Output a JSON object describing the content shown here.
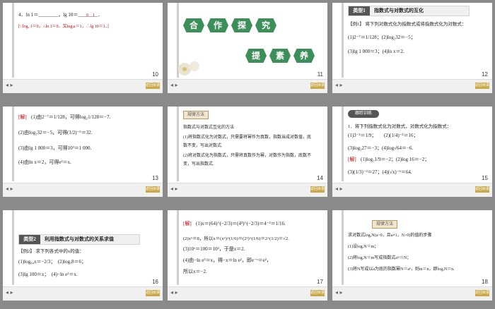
{
  "slides": [
    {
      "page": "10",
      "line1": "4．ln 1＝________，lg 10＝________．",
      "answer1": "0　1",
      "answer2": "[∵logₐ 1＝0，∴ln 1＝0．又logₐa＝1，∴lg 10＝1．]",
      "btn": "返回目录"
    },
    {
      "page": "11",
      "title_chars": [
        "合",
        "作",
        "探",
        "究"
      ],
      "sub_chars": [
        "提",
        "素",
        "养"
      ],
      "btn": "返回目录"
    },
    {
      "page": "12",
      "tag": "类型1",
      "title": "指数式与对数式的互化",
      "example": "【例1】 将下列对数式化为指数式或将指数式化为对数式：",
      "line1": "(1)2⁻⁷＝1/128；(2)log₂32＝−5；",
      "line2": "(3)lg 1 000＝3；(4)ln x＝2.",
      "btn": "返回目录"
    },
    {
      "page": "13",
      "label": "[解]",
      "line1": "(1)由2⁻⁷＝1/128，可得log₂1/128＝−7.",
      "line2": "(2)由log₂32＝−5，可得(1/2)⁻⁵＝32.",
      "line3": "(3)由lg 1 000＝3，可得10³＝1 000.",
      "line4": "(4)由ln x＝2，可得e²＝x.",
      "btn": "返回目录"
    },
    {
      "page": "14",
      "method": "规律方法",
      "line1": "指数式与对数式互化的方法",
      "line2": "(1)将指数式化为对数式，只需要将幂作为真数，指数当成对数值，底",
      "line3": "数不变，写出对数式.",
      "line4": "(2)将对数式化为指数式，只需将真数作为幂，对数作为指数，底数不",
      "line5": "变，写出指数式.",
      "btn": "返回目录"
    },
    {
      "page": "15",
      "pill": "跟踪训练",
      "line1": "1．将下列指数式化为对数式，对数式化为指数式：",
      "line2": "(1)3⁻²＝1/9；　　(2)(1/4)⁻²＝16；",
      "line3": "(3)log₃27＝−3；(4)log√64＝−6.",
      "label": "[解]",
      "line4": "(1)log₃1/9＝−2；(2)log 16＝−2；",
      "line5": "(3)(1/3)⁻³＝27；(4)(√x)⁻⁶＝64.",
      "btn": "返回目录"
    },
    {
      "page": "16",
      "tag": "类型2",
      "title": "利用指数式与对数式的关系求值",
      "example": "【例2】 求下列各式中的x的值：",
      "line1": "(1)log₆₄x＝−2/3；　(2)logₓ8＝6；",
      "line2": "(3)lg 100＝x；　(4)−ln e²＝x.",
      "btn": "返回目录"
    },
    {
      "page": "17",
      "label": "[解]",
      "line1": "(1)x＝(64)^(−2/3)＝(4³)^(−2/3)＝4⁻²＝1/16.",
      "line2": "(2)x⁶＝8，所以x＝(x⁶)^(1/6)＝(2³)^(1/6)＝2^(1/2)＝√2.",
      "line3": "(3)10ˣ＝100＝10²，于是x＝2.",
      "line4": "(4)由−ln e²＝x，得−x＝ln e²，即e⁻ˣ＝e²，",
      "line5": "所以x＝−2.",
      "btn": "返回目录"
    },
    {
      "page": "18",
      "method": "规律方法",
      "line1": "求对数式logₐN(a>0，且a≠1，N>0)的值的步骤",
      "line2": "(1)设logₐN＝m；",
      "line3": "(2)将logₐN＝m写成指数式aᵐ＝N；",
      "line4": "(3)将N写成以a为底的指数幂N＝aⁿ，则m＝n，即logₐN＝n.",
      "btn": "返回目录"
    }
  ],
  "footer_controls": "◂ ▸",
  "colors": {
    "accent_green": "#3d8f5a",
    "red": "#c00000",
    "button_gold": "#caa94a"
  }
}
